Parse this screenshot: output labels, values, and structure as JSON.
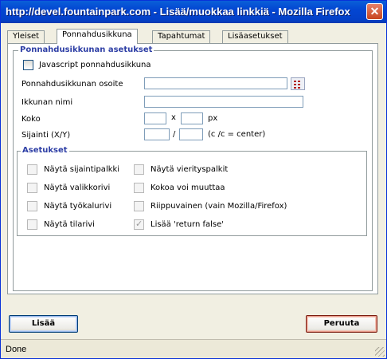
{
  "window": {
    "title": "http://devel.fountainpark.com - Lisää/muokkaa linkkiä - Mozilla Firefox",
    "close_glyph": "✕"
  },
  "tabs": [
    {
      "label": "Yleiset"
    },
    {
      "label": "Ponnahdusikkuna",
      "active": true
    },
    {
      "label": "Tapahtumat"
    },
    {
      "label": "Lisäasetukset"
    }
  ],
  "popup_settings": {
    "legend": "Ponnahdusikkunan asetukset",
    "javascript_checkbox": "Javascript ponnahdusikkuna",
    "url_label": "Ponnahdusikkunan osoite",
    "url_value": "",
    "window_name_label": "Ikkunan nimi",
    "window_name_value": "",
    "size_label": "Koko",
    "size_separator": "x",
    "size_unit": "px",
    "position_label": "Sijainti (X/Y)",
    "position_separator": "/",
    "position_hint": "(c /c = center)"
  },
  "options": {
    "legend": "Asetukset",
    "left": [
      {
        "label": "Näytä sijaintipalkki",
        "checked": false
      },
      {
        "label": "Näytä valikkorivi",
        "checked": false
      },
      {
        "label": "Näytä työkalurivi",
        "checked": false
      },
      {
        "label": "Näytä tilarivi",
        "checked": false
      }
    ],
    "right": [
      {
        "label": "Näytä vierityspalkit",
        "checked": false
      },
      {
        "label": "Kokoa voi muuttaa",
        "checked": false
      },
      {
        "label": "Riippuvainen (vain Mozilla/Firefox)",
        "checked": false
      },
      {
        "label": "Lisää 'return false'",
        "checked": true
      }
    ]
  },
  "buttons": {
    "insert": "Lisää",
    "cancel": "Peruuta"
  },
  "status": {
    "text": "Done"
  },
  "colors": {
    "titlebar": "#0346d2",
    "legend": "#2d3ea5",
    "cancel_border": "#7a1c10"
  }
}
